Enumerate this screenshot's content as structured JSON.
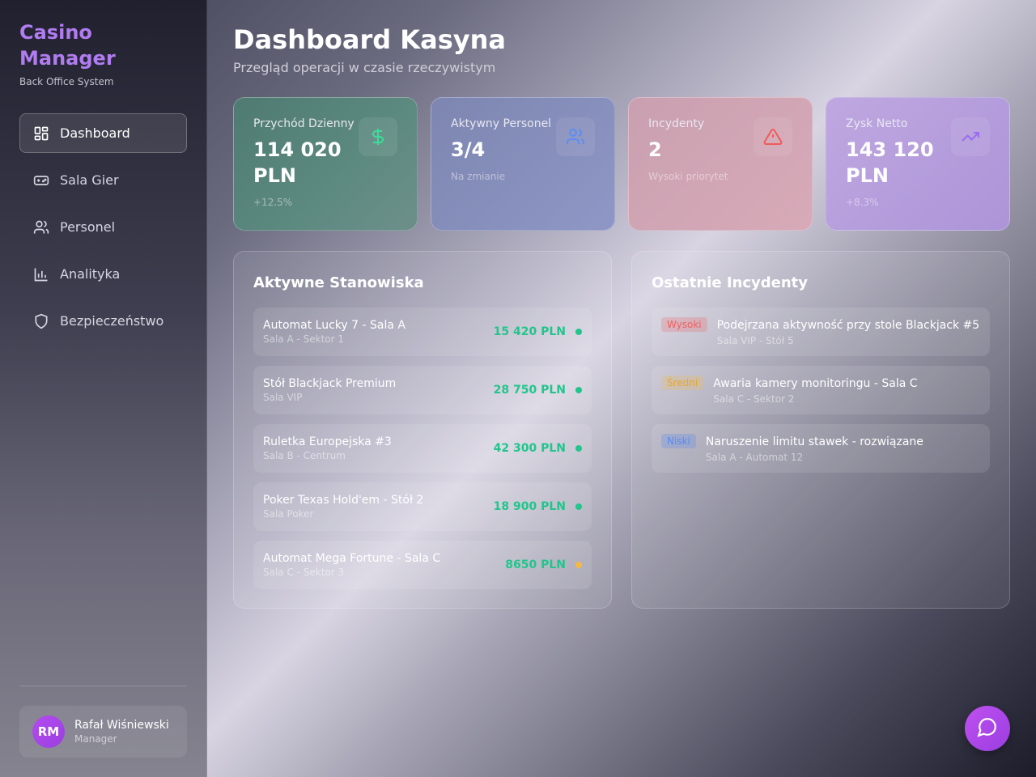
{
  "brand": {
    "title": "Casino Manager",
    "subtitle": "Back Office System"
  },
  "nav": {
    "items": [
      {
        "label": "Dashboard",
        "icon": "dashboard-icon",
        "active": true
      },
      {
        "label": "Sala Gier",
        "icon": "gamepad-icon"
      },
      {
        "label": "Personel",
        "icon": "users-icon"
      },
      {
        "label": "Analityka",
        "icon": "bar-chart-icon"
      },
      {
        "label": "Bezpieczeństwo",
        "icon": "shield-icon"
      }
    ]
  },
  "user": {
    "initials": "RM",
    "name": "Rafał Wiśniewski",
    "role": "Manager"
  },
  "header": {
    "title": "Dashboard Kasyna",
    "subtitle": "Przegląd operacji w czasie rzeczywistym"
  },
  "stats": [
    {
      "label": "Przychód Dzienny",
      "value": "114 020 PLN",
      "foot": "+12.5%",
      "icon": "dollar-icon",
      "color": "#3ddc97"
    },
    {
      "label": "Aktywny Personel",
      "value": "3/4",
      "foot": "Na zmianie",
      "icon": "users-icon",
      "color": "#5b8df5"
    },
    {
      "label": "Incydenty",
      "value": "2",
      "foot": "Wysoki priorytet",
      "icon": "warning-icon",
      "color": "#f05a5a"
    },
    {
      "label": "Zysk Netto",
      "value": "143 120 PLN",
      "foot": "+8.3%",
      "icon": "trending-up-icon",
      "color": "#9a6cf0"
    }
  ],
  "stations": {
    "title": "Aktywne Stanowiska",
    "items": [
      {
        "name": "Automat Lucky 7 - Sala A",
        "location": "Sala A - Sektor 1",
        "amount": "15 420 PLN",
        "status": "ok"
      },
      {
        "name": "Stół Blackjack Premium",
        "location": "Sala VIP",
        "amount": "28 750 PLN",
        "status": "ok"
      },
      {
        "name": "Ruletka Europejska #3",
        "location": "Sala B - Centrum",
        "amount": "42 300 PLN",
        "status": "ok"
      },
      {
        "name": "Poker Texas Hold'em - Stół 2",
        "location": "Sala Poker",
        "amount": "18 900 PLN",
        "status": "ok"
      },
      {
        "name": "Automat Mega Fortune - Sala C",
        "location": "Sala C - Sektor 3",
        "amount": "8650 PLN",
        "status": "warn"
      }
    ]
  },
  "incidents": {
    "title": "Ostatnie Incydenty",
    "items": [
      {
        "priority": "Wysoki",
        "level": "high",
        "title": "Podejrzana aktywność przy stole Blackjack #5",
        "location": "Sala VIP - Stół 5"
      },
      {
        "priority": "Średni",
        "level": "mid",
        "title": "Awaria kamery monitoringu - Sala C",
        "location": "Sala C - Sektor 2"
      },
      {
        "priority": "Niski",
        "level": "low",
        "title": "Naruszenie limitu stawek - rozwiązane",
        "location": "Sala A - Automat 12"
      }
    ]
  },
  "fab": {
    "icon": "chat-icon"
  }
}
